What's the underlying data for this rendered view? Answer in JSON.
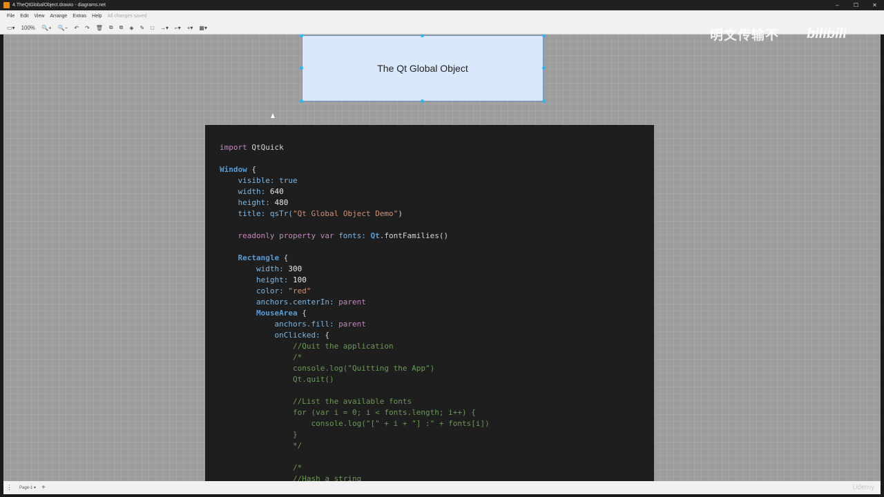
{
  "window": {
    "title": "4.TheQtGlobalObject.drawio - diagrams.net",
    "controls": [
      "–",
      "☐",
      "✕"
    ]
  },
  "menu": {
    "items": [
      "File",
      "Edit",
      "View",
      "Arrange",
      "Extras",
      "Help"
    ],
    "status": "All changes saved"
  },
  "toolbar": {
    "zoom": "100%",
    "items": [
      "▭▾",
      "🔍+",
      "🔍−",
      "↶",
      "↷",
      "🗑",
      "⧉",
      "⧉",
      "◈",
      "✎",
      "□",
      "→▾",
      "⌐▾",
      "+▾",
      "▦▾"
    ]
  },
  "diagram": {
    "shape_label": "The Qt Global Object",
    "shape_fill": "#dae8fc",
    "shape_stroke": "#6c8ebf"
  },
  "code": [
    [
      [
        "import ",
        "kw"
      ],
      [
        "QtQuick",
        "df"
      ]
    ],
    [],
    [
      [
        "Window",
        "ty"
      ],
      [
        " {",
        "df"
      ]
    ],
    [
      [
        "    visible: ",
        "pr"
      ],
      [
        "true",
        "pr"
      ]
    ],
    [
      [
        "    width: ",
        "pr"
      ],
      [
        "640",
        "nu"
      ]
    ],
    [
      [
        "    height: ",
        "pr"
      ],
      [
        "480",
        "nu"
      ]
    ],
    [
      [
        "    title: ",
        "pr"
      ],
      [
        "qsTr(",
        "pr"
      ],
      [
        "\"Qt Global Object Demo\"",
        "st"
      ],
      [
        ")",
        "df"
      ]
    ],
    [],
    [
      [
        "    readonly property var ",
        "kw"
      ],
      [
        "fonts: ",
        "pr"
      ],
      [
        "Qt",
        "ty"
      ],
      [
        ".fontFamilies()",
        "df"
      ]
    ],
    [],
    [
      [
        "    ",
        "df"
      ],
      [
        "Rectangle",
        "ty"
      ],
      [
        " {",
        "df"
      ]
    ],
    [
      [
        "        width: ",
        "pr"
      ],
      [
        "300",
        "nu"
      ]
    ],
    [
      [
        "        height: ",
        "pr"
      ],
      [
        "100",
        "nu"
      ]
    ],
    [
      [
        "        color: ",
        "pr"
      ],
      [
        "\"red\"",
        "st"
      ]
    ],
    [
      [
        "        anchors.centerIn: ",
        "pr"
      ],
      [
        "parent",
        "kw"
      ]
    ],
    [
      [
        "        ",
        "df"
      ],
      [
        "MouseArea",
        "ty"
      ],
      [
        " {",
        "df"
      ]
    ],
    [
      [
        "            anchors.fill: ",
        "pr"
      ],
      [
        "parent",
        "kw"
      ]
    ],
    [
      [
        "            onClicked: ",
        "pr"
      ],
      [
        "{",
        "df"
      ]
    ],
    [
      [
        "                //Quit the application",
        "cm"
      ]
    ],
    [
      [
        "                /*",
        "cm"
      ]
    ],
    [
      [
        "                console.log(\"Quitting the App\")",
        "cm"
      ]
    ],
    [
      [
        "                Qt.quit()",
        "cm"
      ]
    ],
    [],
    [
      [
        "                //List the available fonts",
        "cm"
      ]
    ],
    [
      [
        "                for (var i = 0; i < fonts.length; i++) {",
        "cm"
      ]
    ],
    [
      [
        "                    console.log(\"[\" + i + \"] :\" + fonts[i])",
        "cm"
      ]
    ],
    [
      [
        "                }",
        "cm"
      ]
    ],
    [
      [
        "                */",
        "cm"
      ]
    ],
    [],
    [
      [
        "                /*",
        "cm"
      ]
    ],
    [
      [
        "                //Hash a string",
        "cm"
      ]
    ]
  ],
  "overlay": {
    "watermark": "明文传输不",
    "logo": "bilibili",
    "udemy": "Udemy"
  },
  "bottom": {
    "page": "Page-1 ▾",
    "add": "+",
    "menu": "⋮"
  }
}
